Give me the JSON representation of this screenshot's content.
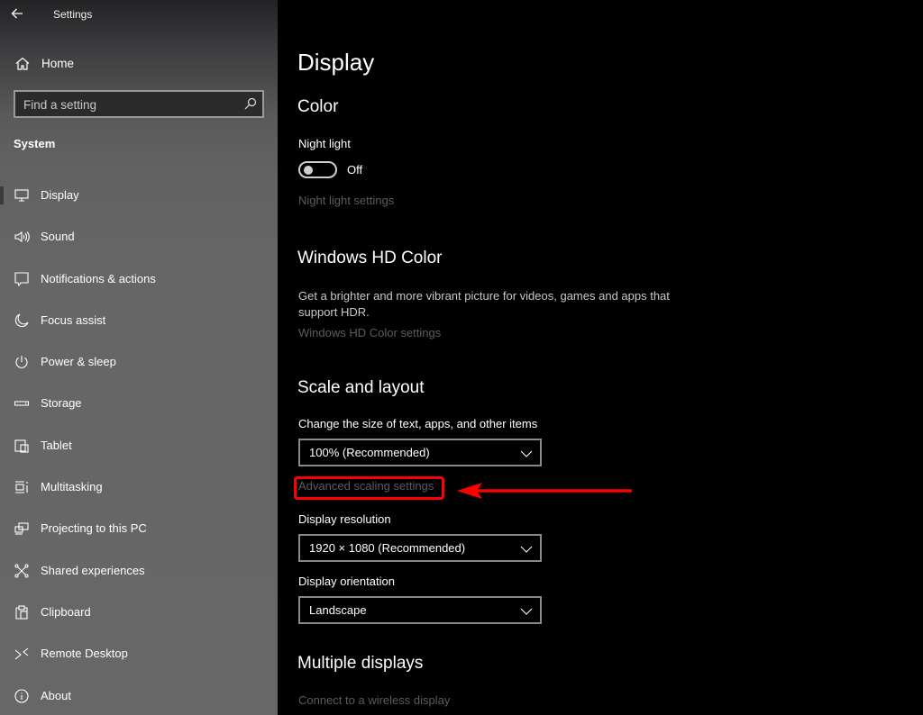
{
  "window": {
    "title": "Settings",
    "back_icon": "back-arrow-icon"
  },
  "sidebar": {
    "home": {
      "label": "Home",
      "icon": "home-icon"
    },
    "search": {
      "placeholder": "Find a setting",
      "value": "",
      "icon": "search-icon"
    },
    "section_label": "System",
    "items": [
      {
        "label": "Display",
        "icon": "monitor-icon",
        "active": true
      },
      {
        "label": "Sound",
        "icon": "speaker-icon"
      },
      {
        "label": "Notifications & actions",
        "icon": "notification-icon"
      },
      {
        "label": "Focus assist",
        "icon": "moon-icon"
      },
      {
        "label": "Power & sleep",
        "icon": "power-icon"
      },
      {
        "label": "Storage",
        "icon": "storage-icon"
      },
      {
        "label": "Tablet",
        "icon": "tablet-icon"
      },
      {
        "label": "Multitasking",
        "icon": "multitasking-icon"
      },
      {
        "label": "Projecting to this PC",
        "icon": "projecting-icon"
      },
      {
        "label": "Shared experiences",
        "icon": "shared-experiences-icon"
      },
      {
        "label": "Clipboard",
        "icon": "clipboard-icon"
      },
      {
        "label": "Remote Desktop",
        "icon": "remote-desktop-icon"
      },
      {
        "label": "About",
        "icon": "info-icon"
      }
    ]
  },
  "main": {
    "title": "Display",
    "color": {
      "heading": "Color",
      "night_light_label": "Night light",
      "night_light_state": "Off",
      "night_light_on": false,
      "night_light_settings_link": "Night light settings"
    },
    "hd_color": {
      "heading": "Windows HD Color",
      "description": "Get a brighter and more vibrant picture for videos, games and apps that support HDR.",
      "settings_link": "Windows HD Color settings"
    },
    "scale_layout": {
      "heading": "Scale and layout",
      "scale_label": "Change the size of text, apps, and other items",
      "scale_value": "100% (Recommended)",
      "advanced_link": "Advanced scaling settings",
      "resolution_label": "Display resolution",
      "resolution_value": "1920 × 1080 (Recommended)",
      "orientation_label": "Display orientation",
      "orientation_value": "Landscape"
    },
    "multiple_displays": {
      "heading": "Multiple displays",
      "connect_link": "Connect to a wireless display"
    }
  },
  "annotation": {
    "color": "#ff0000",
    "target": "Advanced scaling settings"
  }
}
